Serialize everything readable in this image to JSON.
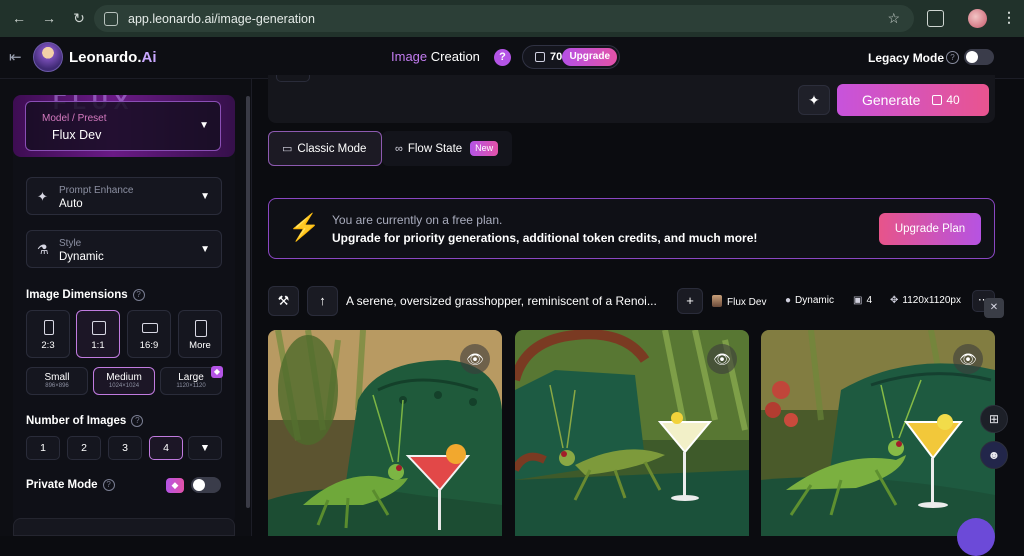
{
  "browser": {
    "url": "app.leonardo.ai/image-generation",
    "nav_icons": [
      "back-icon",
      "forward-icon",
      "reload-icon"
    ]
  },
  "header": {
    "brand": "Leonardo.",
    "brand_suffix": "Ai",
    "section_img": "Image",
    "section_rest": "Creation",
    "help": "?",
    "tokens": "70",
    "upgrade": "Upgrade",
    "legacy_label": "Legacy Mode",
    "legacy_on": false
  },
  "sidebar": {
    "model_label": "Model / Preset",
    "model_value": "Flux Dev",
    "model_banner": "FLUX",
    "prompt_enhance_label": "Prompt Enhance",
    "prompt_enhance_value": "Auto",
    "style_label": "Style",
    "style_value": "Dynamic",
    "dimensions_title": "Image Dimensions",
    "ratios": [
      {
        "label": "2:3"
      },
      {
        "label": "1:1",
        "active": true
      },
      {
        "label": "16:9"
      },
      {
        "label": "More"
      }
    ],
    "sizes": [
      {
        "label": "Small",
        "sub": "896×896"
      },
      {
        "label": "Medium",
        "sub": "1024×1024",
        "active": true
      },
      {
        "label": "Large",
        "sub": "1120×1120"
      }
    ],
    "num_title": "Number of Images",
    "nums": [
      "1",
      "2",
      "3",
      "4"
    ],
    "num_selected": "4",
    "private_label": "Private Mode",
    "private_on": false
  },
  "main": {
    "generate_label": "Generate",
    "generate_cost": "40",
    "modes": [
      {
        "label": "Classic Mode",
        "active": true
      },
      {
        "label": "Flow State",
        "badge": "New"
      }
    ],
    "banner_line1": "You are currently on a free plan.",
    "banner_line2": "Upgrade for priority generations, additional token credits, and much more!",
    "upgrade_plan": "Upgrade Plan",
    "generation": {
      "prompt": "A serene, oversized grasshopper, reminiscent of a Renoi...",
      "model": "Flux Dev",
      "style": "Dynamic",
      "count": "4",
      "dimensions": "1120x1120px"
    }
  },
  "colors": {
    "accent_purple": "#b454e6",
    "accent_pink": "#e9548f",
    "banner_border": "#8a47c2",
    "bolt": "#f2c12e"
  }
}
